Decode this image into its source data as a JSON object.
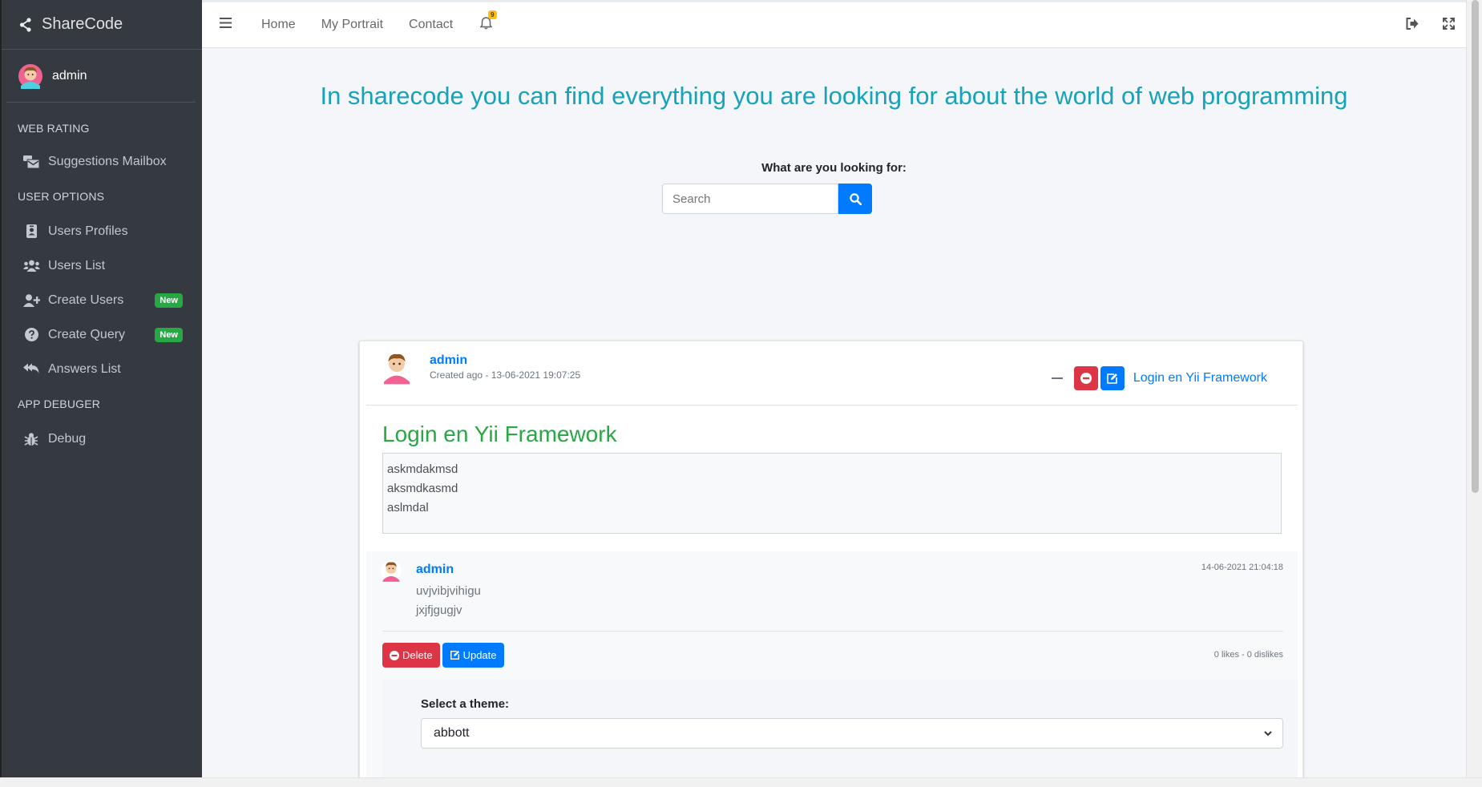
{
  "brand": {
    "name": "ShareCode"
  },
  "user_panel": {
    "name": "admin"
  },
  "sidebar": {
    "sections": [
      {
        "header": "WEB RATING",
        "items": [
          {
            "label": "Suggestions Mailbox",
            "icon": "mail-bulk-icon"
          }
        ]
      },
      {
        "header": "USER OPTIONS",
        "items": [
          {
            "label": "Users Profiles",
            "icon": "id-badge-icon"
          },
          {
            "label": "Users List",
            "icon": "users-icon"
          },
          {
            "label": "Create Users",
            "icon": "user-plus-icon",
            "badge": "New"
          },
          {
            "label": "Create Query",
            "icon": "question-circle-icon",
            "badge": "New"
          },
          {
            "label": "Answers List",
            "icon": "reply-all-icon"
          }
        ]
      },
      {
        "header": "APP DEBUGER",
        "items": [
          {
            "label": "Debug",
            "icon": "bug-icon"
          }
        ]
      }
    ],
    "badge_color": "#28a745"
  },
  "navbar": {
    "links": [
      "Home",
      "My Portrait",
      "Contact"
    ],
    "notification_count": "9"
  },
  "hero": {
    "title": "In sharecode you can find everything you are looking for about the world of web programming"
  },
  "search": {
    "label": "What are you looking for:",
    "placeholder": "Search"
  },
  "post": {
    "author": "admin",
    "meta": "Created ago - 13-06-2021 19:07:25",
    "tool_link": "Login en Yii Framework",
    "title": "Login en Yii Framework",
    "body_lines": [
      "askmdakmsd",
      "aksmdkasmd",
      "aslmdal"
    ]
  },
  "comment": {
    "author": "admin",
    "date": "14-06-2021 21:04:18",
    "lines": [
      "uvjvibjvihigu",
      "jxjfjgugjv"
    ],
    "delete_label": "Delete",
    "update_label": "Update",
    "likes": "0 likes - 0 dislikes"
  },
  "theme": {
    "label": "Select a theme:",
    "selected": "abbott"
  },
  "colors": {
    "accent": "#17a2b8",
    "primary": "#007bff",
    "danger": "#dc3545",
    "success": "#28a745",
    "sidebar": "#343a40"
  }
}
